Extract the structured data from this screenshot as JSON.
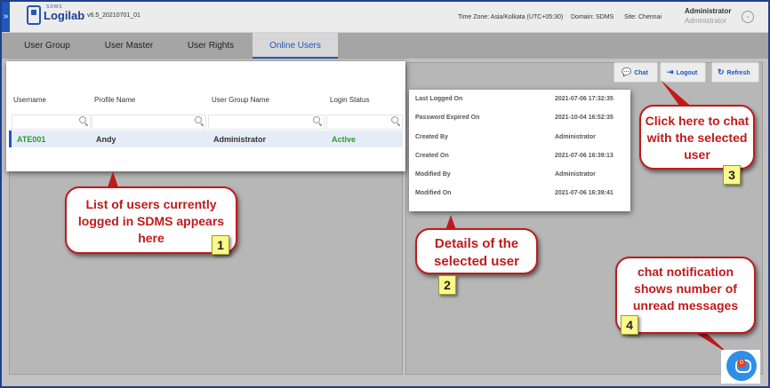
{
  "header": {
    "brand": "Logilab",
    "brand_small": "SDMS",
    "version": "v6.5_20210701_01",
    "timezone": "Time Zone: Asia/Kolkata (UTC+05:30)",
    "domain": "Domain: SDMS",
    "site": "Site: Chennai",
    "user_name": "Administrator",
    "user_role": "Administrator"
  },
  "tabs": [
    "User Group",
    "User Master",
    "User Rights",
    "Online Users"
  ],
  "table": {
    "headers": [
      "Username",
      "Profile Name",
      "User Group Name",
      "Login Status"
    ],
    "rows": [
      [
        "ATE001",
        "Andy",
        "Administrator",
        "Active"
      ]
    ]
  },
  "details": [
    {
      "label": "Last Logged On",
      "value": "2021-07-06 17:32:35"
    },
    {
      "label": "Password Expired On",
      "value": "2021-10-04 16:52:35"
    },
    {
      "label": "Created By",
      "value": "Administrator"
    },
    {
      "label": "Created On",
      "value": "2021-07-06 16:39:13"
    },
    {
      "label": "Modified By",
      "value": "Administrator"
    },
    {
      "label": "Modified On",
      "value": "2021-07-06 16:39:41"
    }
  ],
  "buttons": {
    "chat": "Chat",
    "logout": "Logout",
    "refresh": "Refresh"
  },
  "callouts": {
    "c1": "List of users currently logged in SDMS appears here",
    "c2": "Details of the selected user",
    "c3": "Click here to chat with the selected user",
    "c4": "chat notification shows number of unread messages"
  },
  "tags": [
    "1",
    "2",
    "3",
    "4"
  ],
  "chat_badge": "0",
  "colors": {
    "accent": "#1e58b8",
    "active_status": "#2e9a2e",
    "callout_red": "#c11a1a",
    "tag_yellow": "#fbf98a",
    "chat_blue": "#2e8fe6"
  }
}
